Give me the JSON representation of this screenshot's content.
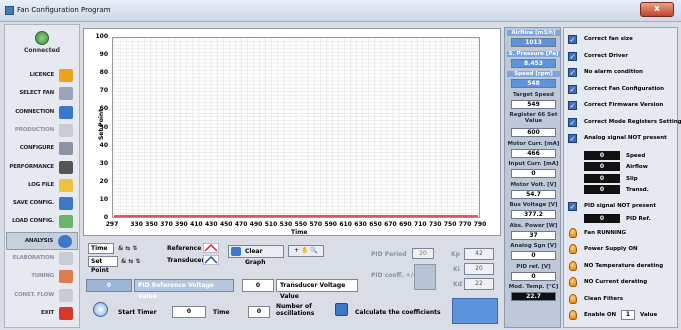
{
  "window": {
    "title": "Fan Configuration Program",
    "close_label": "x"
  },
  "sidebar": {
    "connection_status": "Connected",
    "items": [
      {
        "label": "LICENCE",
        "enabled": true,
        "icon": "lock-icon"
      },
      {
        "label": "SELECT FAN",
        "enabled": true,
        "icon": "fan-icon"
      },
      {
        "label": "CONNECTION",
        "enabled": true,
        "icon": "connection-icon"
      },
      {
        "label": "PRODUCTION",
        "enabled": false,
        "icon": "production-icon"
      },
      {
        "label": "CONFIGURE",
        "enabled": true,
        "icon": "configure-icon"
      },
      {
        "label": "PERFORMANCE",
        "enabled": true,
        "icon": "performance-icon"
      },
      {
        "label": "LOG FILE",
        "enabled": true,
        "icon": "logfile-icon"
      },
      {
        "label": "SAVE CONFIG.",
        "enabled": true,
        "icon": "save-icon"
      },
      {
        "label": "LOAD CONFIG.",
        "enabled": true,
        "icon": "load-icon"
      },
      {
        "label": "ANALYSIS",
        "enabled": true,
        "icon": "analysis-icon"
      },
      {
        "label": "ELABORATION",
        "enabled": false,
        "icon": "elaboration-icon"
      },
      {
        "label": "TUNING",
        "enabled": false,
        "icon": "tuning-icon"
      },
      {
        "label": "CONST. FLOW",
        "enabled": false,
        "icon": "constflow-icon"
      },
      {
        "label": "EXIT",
        "enabled": true,
        "icon": "exit-icon"
      }
    ]
  },
  "chart_data": {
    "type": "line",
    "ylabel": "Set Point",
    "xlabel": "Time",
    "ylim": [
      0,
      100
    ],
    "xlim": [
      297,
      790
    ],
    "y_ticks": [
      "100",
      "90",
      "80",
      "70",
      "60",
      "50",
      "40",
      "30",
      "20",
      "10",
      "0"
    ],
    "x_ticks": [
      "297",
      "330",
      "350",
      "370",
      "390",
      "410",
      "430",
      "450",
      "470",
      "490",
      "510",
      "530",
      "550",
      "570",
      "590",
      "610",
      "630",
      "650",
      "670",
      "690",
      "710",
      "730",
      "750",
      "770",
      "790"
    ],
    "series": [
      {
        "x": [
          297,
          790
        ],
        "y": [
          0,
          0
        ],
        "color": "#e02020"
      }
    ],
    "grid": true
  },
  "controls": {
    "time_label": "Time",
    "setpoint_label": "Set Point",
    "reference_label": "Reference",
    "transducer_label": "Transducer",
    "clear_graph_label": "Clear Graph",
    "pid_period_label": "PID Period",
    "pid_period_value": "20",
    "kp_label": "Kp",
    "kp_value": "42",
    "ki_label": "Ki",
    "ki_value": "20",
    "kd_label": "Kd",
    "kd_value": "22",
    "pid_coeff_label": "PID coeff. +/-",
    "pid_ref_voltage_value": "0",
    "pid_ref_voltage_label": "PID Reference Voltage Value",
    "transducer_voltage_value": "0",
    "transducer_voltage_label": "Transducer Voltage Value",
    "start_timer_label": "Start  Timer",
    "timer_value": "0",
    "time_label2": "Time",
    "oscillations_value": "0",
    "oscillations_label": "Number of oscillations",
    "calc_coeff_label": "Calculate the coefficients"
  },
  "readouts": {
    "airflow_label": "Airflow [m3/h]",
    "airflow_value": "1013",
    "spressure_label": "S. Pressure [Pa]",
    "spressure_value": "8.453",
    "speed_label": "Speed [rpm]",
    "speed_value": "548",
    "target_speed_label": "Target Speed",
    "target_speed_value": "549",
    "register_label": "Register 66 Set Value",
    "register_value": "600",
    "motor_curr_label": "Motor Curr. [mA]",
    "motor_curr_value": "466",
    "input_curr_label": "Input Curr. [mA]",
    "input_curr_value": "0",
    "motor_volt_label": "Motor Volt. [V]",
    "motor_volt_value": "54.7",
    "bus_voltage_label": "Bus Voltage [V]",
    "bus_voltage_value": "377.2",
    "abs_power_label": "Abs. Power [W]",
    "abs_power_value": "37",
    "analog_sgn_label": "Analog Sgn [V]",
    "analog_sgn_value": "0",
    "pid_ref_label": "PID ref. [V]",
    "pid_ref_value": "0",
    "mod_temp_label": "Mod. Temp. [°C]",
    "mod_temp_value": "22.7"
  },
  "status": {
    "checks": [
      "Correct fan size",
      "Correct Driver",
      "No alarm condition",
      "Correct  Fan Configuration",
      "Correct Firmware Version",
      "Correct Mode Registers Setting",
      "Analog signal NOT present"
    ],
    "disp": [
      {
        "value": "0",
        "label": "Speed"
      },
      {
        "value": "0",
        "label": "Airflow"
      },
      {
        "value": "0",
        "label": "Slip"
      },
      {
        "value": "0",
        "label": "Transd."
      }
    ],
    "pid_signal_label": "PID signal NOT present",
    "pid_ref_box": "0",
    "pid_ref_box_label": "PID Ref.",
    "lamps": [
      "Fan RUNNING",
      "Power Supply ON",
      "NO Temperature derating",
      "NO Current derating",
      "Clean Filters"
    ],
    "enable_on_label": "Enable ON",
    "enable_on_value": "1",
    "value_label": "Value"
  }
}
